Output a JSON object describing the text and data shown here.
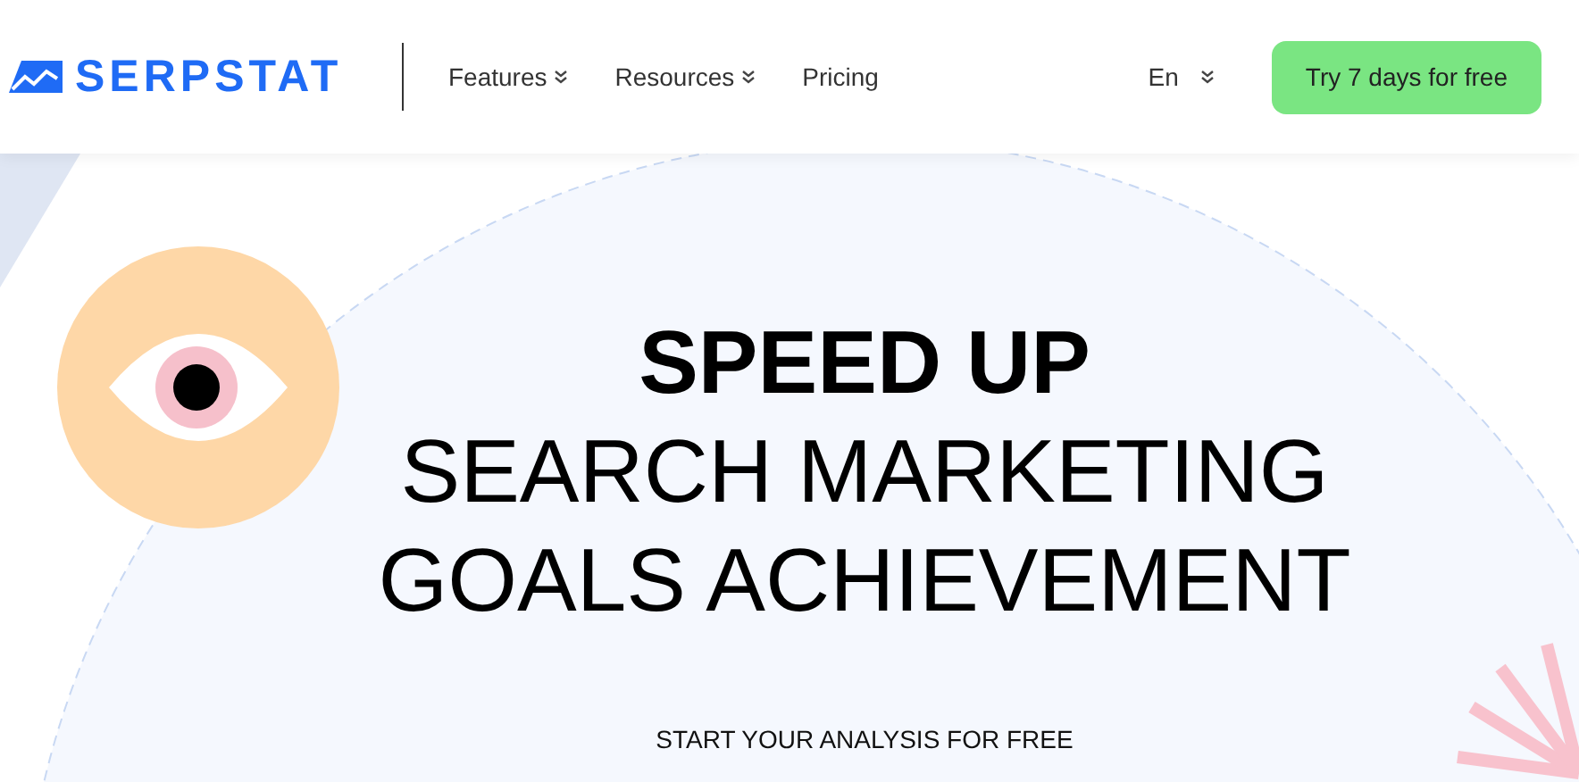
{
  "header": {
    "logo": "SERPSTAT",
    "nav": [
      {
        "label": "Features",
        "dropdown": true
      },
      {
        "label": "Resources",
        "dropdown": true
      },
      {
        "label": "Pricing",
        "dropdown": false
      }
    ],
    "language": {
      "label": "En",
      "dropdown": true
    },
    "cta": "Try 7 days for free"
  },
  "hero": {
    "title_bold": "SPEED UP",
    "title_lines": [
      "SEARCH MARKETING",
      "GOALS ACHIEVEMENT"
    ],
    "subtitle": "START YOUR ANALYSIS FOR FREE"
  }
}
